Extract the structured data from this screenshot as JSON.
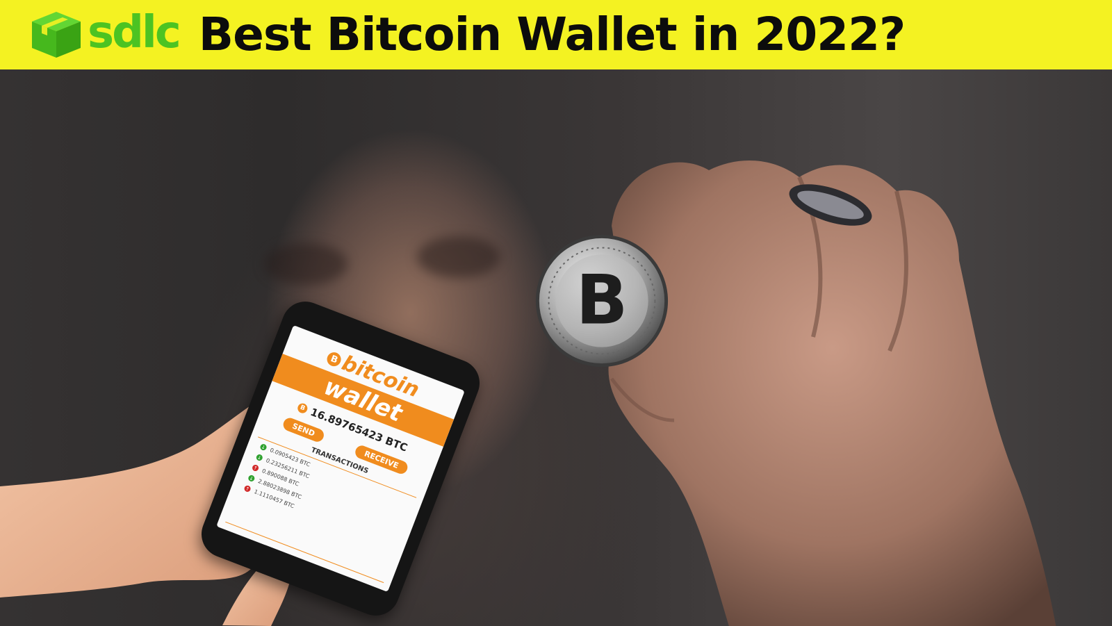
{
  "banner": {
    "logo_text": "sdlc",
    "title": "Best Bitcoin Wallet in 2022?",
    "background_color": "#f4f222",
    "logo_color": "#4cc322"
  },
  "phone_screen": {
    "brand_line_1": "bitcoin",
    "brand_line_2": "wallet",
    "currency_symbol": "B",
    "balance": "16.89765423 BTC",
    "send_label": "SEND",
    "receive_label": "RECEIVE",
    "transactions_heading": "TRANSACTIONS",
    "transactions": [
      {
        "amount": "0.0905423 BTC",
        "direction": "in"
      },
      {
        "amount": "0.23256211 BTC",
        "direction": "in"
      },
      {
        "amount": "0.890088 BTC",
        "direction": "out"
      },
      {
        "amount": "2.88023898 BTC",
        "direction": "in"
      },
      {
        "amount": "1.1110457 BTC",
        "direction": "out"
      }
    ],
    "accent_color": "#f08c1e",
    "incoming_color": "#2fa12f",
    "outgoing_color": "#d22a2a"
  },
  "coin": {
    "symbol": "B"
  }
}
